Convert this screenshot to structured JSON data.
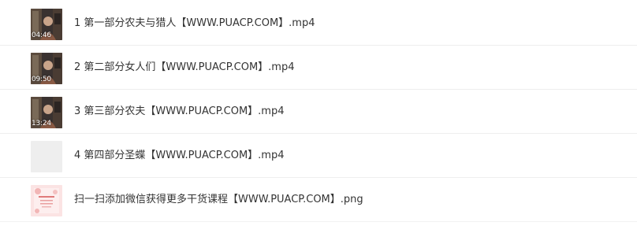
{
  "files": [
    {
      "name": "1 第一部分农夫与猎人【WWW.PUACP.COM】.mp4",
      "duration": "04:46",
      "thumb": "video"
    },
    {
      "name": "2 第二部分女人们【WWW.PUACP.COM】.mp4",
      "duration": "09:50",
      "thumb": "video"
    },
    {
      "name": "3 第三部分农夫【WWW.PUACP.COM】.mp4",
      "duration": "13:24",
      "thumb": "video"
    },
    {
      "name": "4 第四部分圣蝶【WWW.PUACP.COM】.mp4",
      "duration": "",
      "thumb": "blank"
    },
    {
      "name": "扫一扫添加微信获得更多干货课程【WWW.PUACP.COM】.png",
      "duration": "",
      "thumb": "image"
    }
  ]
}
